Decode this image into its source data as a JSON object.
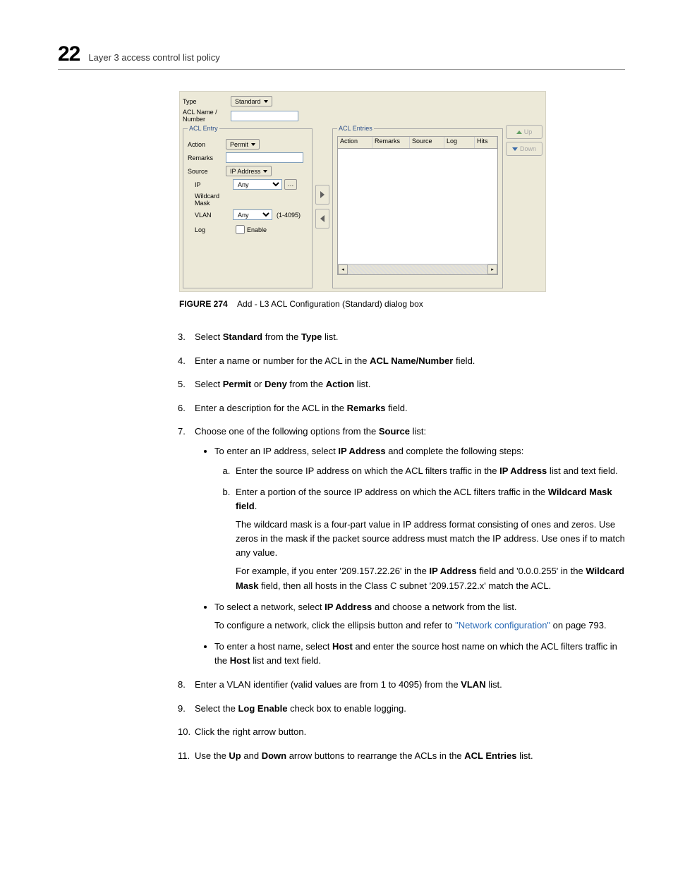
{
  "header": {
    "chapter_number": "22",
    "chapter_title": "Layer 3 access control list policy"
  },
  "shot": {
    "type_label": "Type",
    "type_value": "Standard",
    "name_label": "ACL Name / Number",
    "entry_legend": "ACL Entry",
    "entries_legend": "ACL Entries",
    "action_label": "Action",
    "action_value": "Permit",
    "remarks_label": "Remarks",
    "source_label": "Source",
    "source_value": "IP Address",
    "ip_label": "IP",
    "ip_value": "Any",
    "wmask_label": "Wildcard Mask",
    "vlan_label": "VLAN",
    "vlan_value": "Any",
    "vlan_hint": "(1-4095)",
    "log_label": "Log",
    "log_check": "Enable",
    "cols": {
      "c1": "Action",
      "c2": "Remarks",
      "c3": "Source",
      "c4": "Log",
      "c5": "Hits"
    },
    "up": "Up",
    "down": "Down"
  },
  "caption": {
    "label": "FIGURE 274",
    "text": "Add - L3 ACL Configuration (Standard) dialog box"
  },
  "s3": {
    "a": "Select ",
    "b": "Standard",
    "c": " from the ",
    "d": "Type",
    "e": " list."
  },
  "s4": {
    "a": "Enter a name or number for the ACL in the ",
    "b": "ACL Name/Number",
    "c": " field."
  },
  "s5": {
    "a": "Select ",
    "b": "Permit",
    "c": " or ",
    "d": "Deny",
    "e": " from the ",
    "f": "Action",
    "g": " list."
  },
  "s6": {
    "a": "Enter a description for the ACL in the ",
    "b": "Remarks",
    "c": " field."
  },
  "s7": {
    "a": "Choose one of the following options from the ",
    "b": "Source",
    "c": " list:"
  },
  "b1": {
    "a": "To enter an IP address, select ",
    "b": "IP Address",
    "c": " and complete the following steps:"
  },
  "a1": {
    "a": "Enter the source IP address on which the ACL filters traffic in the ",
    "b": "IP Address",
    "c": " list and text field."
  },
  "a2": {
    "a": "Enter a portion of the source IP address on which the ACL filters traffic in the ",
    "b": "Wildcard Mask field",
    "c": ".",
    "p1": "The wildcard mask is a four-part value in IP address format consisting of ones and zeros. Use zeros in the mask if the packet source address must match the IP address. Use ones if to match any value.",
    "p2a": "For example, if you enter '209.157.22.26' in the ",
    "p2b": "IP Address",
    "p2c": " field and '0.0.0.255' in the ",
    "p2d": "Wildcard Mask",
    "p2e": " field, then all hosts in the Class C subnet '209.157.22.x' match the ACL."
  },
  "b2": {
    "a": "To select a network, select ",
    "b": "IP Address",
    "c": " and choose a network from the list.",
    "p1a": "To configure a network, click the ellipsis button and refer to ",
    "p1b": "\"Network configuration\"",
    "p1c": " on page 793."
  },
  "b3": {
    "a": "To enter a host name, select ",
    "b": "Host",
    "c": " and enter the source host name on which the ACL filters traffic in the ",
    "d": "Host",
    "e": " list and text field."
  },
  "s8": {
    "a": "Enter a VLAN identifier (valid values are from 1 to 4095) from the ",
    "b": "VLAN",
    "c": " list."
  },
  "s9": {
    "a": "Select the ",
    "b": "Log Enable",
    "c": " check box to enable logging."
  },
  "s10": {
    "a": "Click the right arrow button."
  },
  "s11": {
    "a": "Use the ",
    "b": "Up",
    "c": " and ",
    "d": "Down",
    "e": " arrow buttons to rearrange the ACLs in the ",
    "f": "ACL Entries",
    "g": " list."
  }
}
